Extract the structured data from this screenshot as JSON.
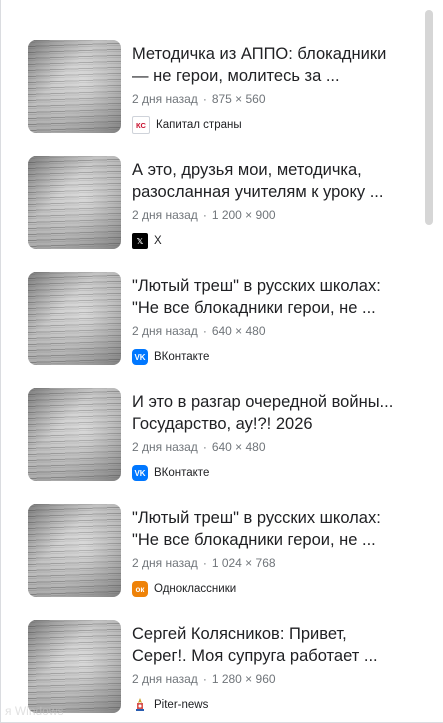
{
  "results": [
    {
      "title_line1": "Методичка из АППО: блокадники",
      "title_line2": "— не герои, молитесь за ...",
      "age": "2 дня назад",
      "dims": "875 × 560",
      "source": "Капитал страны",
      "favicon": "kapital-strany-icon"
    },
    {
      "title_line1": "А это, друзья мои, методичка,",
      "title_line2": "разосланная учителям к уроку ...",
      "age": "2 дня назад",
      "dims": "1 200 × 900",
      "source": "X",
      "favicon": "x-icon"
    },
    {
      "title_line1": "\"Лютый треш\" в русских школах:",
      "title_line2": "\"Не все блокадники герои, не ...",
      "age": "2 дня назад",
      "dims": "640 × 480",
      "source": "ВКонтакте",
      "favicon": "vk-icon"
    },
    {
      "title_line1": "И это в разгар очередной войны...",
      "title_line2": "Государство, ау!?! 2026",
      "age": "2 дня назад",
      "dims": "640 × 480",
      "source": "ВКонтакте",
      "favicon": "vk-icon"
    },
    {
      "title_line1": "\"Лютый треш\" в русских школах:",
      "title_line2": "\"Не все блокадники герои, не ...",
      "age": "2 дня назад",
      "dims": "1 024 × 768",
      "source": "Одноклассники",
      "favicon": "ok-icon"
    },
    {
      "title_line1": "Сергей Колясников: Привет,",
      "title_line2": "Серег!. Моя супруга работает ...",
      "age": "2 дня назад",
      "dims": "1 280 × 960",
      "source": "Piter-news",
      "favicon": "piter-news-icon"
    }
  ],
  "favicon_text": {
    "ks": "КС",
    "x": "𝕏",
    "vk": "VK",
    "ok": "ок"
  },
  "dot": "·",
  "watermark": "я Windows"
}
